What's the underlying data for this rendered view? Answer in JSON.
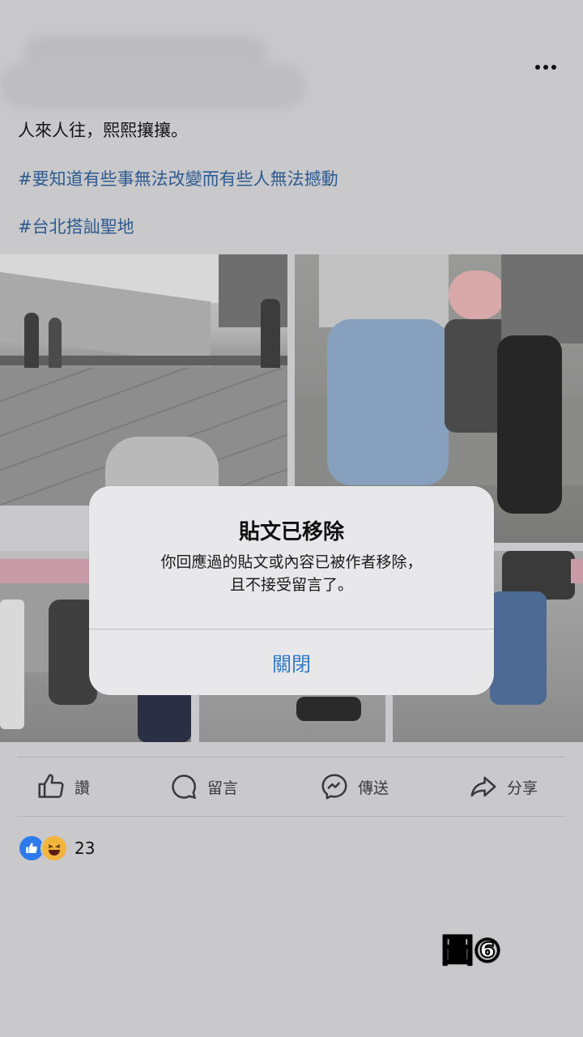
{
  "post": {
    "author_blurred": true,
    "more_icon": "more-horizontal-icon",
    "lines": [
      "人來人往，熙熙攘攘。"
    ],
    "hashtags": [
      "#要知道有些事無法改變而有些人無法撼動",
      "#台北搭訕聖地"
    ]
  },
  "dialog": {
    "title": "貼文已移除",
    "body_line1": "你回應過的貼文或內容已被作者移除，",
    "body_line2": "且不接受留言了。",
    "close_label": "關閉"
  },
  "actions": {
    "like": "讚",
    "comment": "留言",
    "send": "傳送",
    "share": "分享"
  },
  "reactions": {
    "count": "23",
    "icons": [
      "like-reaction-icon",
      "haha-reaction-icon"
    ]
  },
  "figure_label": "圖⑥",
  "colors": {
    "background": "#c9c9cb",
    "hashtag": "#2d5a91",
    "dialog_button": "#3478c8",
    "like_blue": "#2d7bea"
  }
}
